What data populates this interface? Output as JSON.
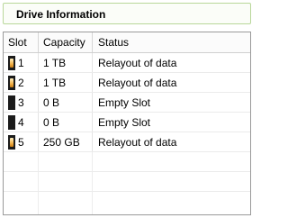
{
  "panel": {
    "title": "Drive Information"
  },
  "table": {
    "headers": {
      "slot": "Slot",
      "capacity": "Capacity",
      "status": "Status"
    },
    "rows": [
      {
        "slot": "1",
        "capacity": "1 TB",
        "status": "Relayout of data",
        "led": true
      },
      {
        "slot": "2",
        "capacity": "1 TB",
        "status": "Relayout of data",
        "led": true
      },
      {
        "slot": "3",
        "capacity": "0 B",
        "status": "Empty Slot",
        "led": false
      },
      {
        "slot": "4",
        "capacity": "0 B",
        "status": "Empty Slot",
        "led": false
      },
      {
        "slot": "5",
        "capacity": "250 GB",
        "status": "Relayout of data",
        "led": true
      }
    ]
  },
  "colors": {
    "led_active": "#f2b24a",
    "drive_body": "#1b1b1b",
    "panel_border": "#b9d79a"
  }
}
